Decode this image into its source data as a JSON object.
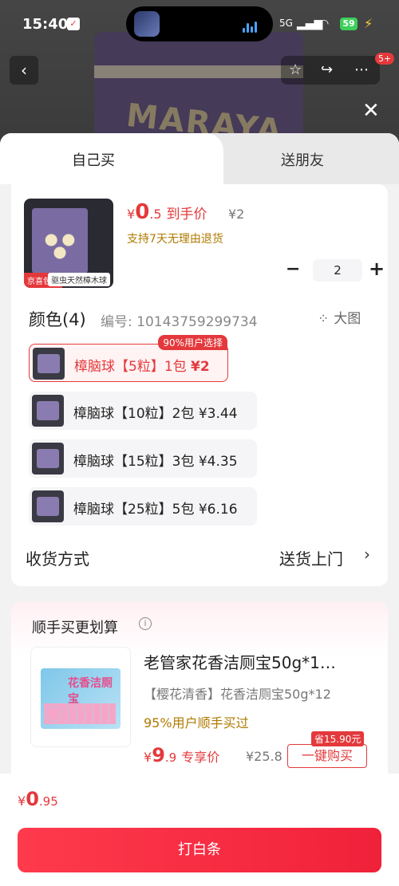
{
  "status_bar": {
    "time": "15:40",
    "network": "5G",
    "battery": "59"
  },
  "nav": {
    "back_icon": "chevron-left-icon",
    "badge": "5+"
  },
  "background_product": {
    "brand_text": "MARAYA"
  },
  "tabs": {
    "self": "自己买",
    "friend": "送朋友"
  },
  "product": {
    "img_tag_a": "京喜包邮",
    "img_tag_b": "驱虫天然樟木球",
    "price_symbol": "¥",
    "price_int": "0",
    "price_dec": ".5",
    "price_label": "到手价",
    "orig_price": "¥2",
    "return_policy": "支持7天无理由退货",
    "quantity": "2",
    "minus": "−",
    "plus": "+"
  },
  "options": {
    "header": "颜色(4)",
    "code": "编号: 10143759299734",
    "big_image": "大图",
    "items": [
      {
        "label": "樟脑球【5粒】1包",
        "price": "¥2",
        "hot": "90%用户选择"
      },
      {
        "label": "樟脑球【10粒】2包",
        "price": "¥3.44"
      },
      {
        "label": "樟脑球【15粒】3包",
        "price": "¥4.35"
      },
      {
        "label": "樟脑球【25粒】5包",
        "price": "¥6.16"
      }
    ]
  },
  "shipping": {
    "label": "收货方式",
    "value": "送货上门",
    "arrow": "›"
  },
  "recommend": {
    "title": "顺手买更划算",
    "info": "i",
    "image_text": "花香洁厕宝",
    "name": "老管家花香洁厕宝50g*1…",
    "sub": "【樱花清香】花香洁厕宝50g*12",
    "pct": "95%用户顺手买过",
    "price_symbol": "¥",
    "price_int": "9",
    "price_dec": ".9",
    "price_label": "专享价",
    "orig_price": "¥25.8",
    "save_tag": "省15.90元",
    "buy_label": "一键购买"
  },
  "bottom": {
    "price_symbol": "¥",
    "price_int": "0",
    "price_dec": ".95",
    "cta": "打白条"
  },
  "colors": {
    "accent": "#e4393c",
    "gold": "#b07a00"
  }
}
